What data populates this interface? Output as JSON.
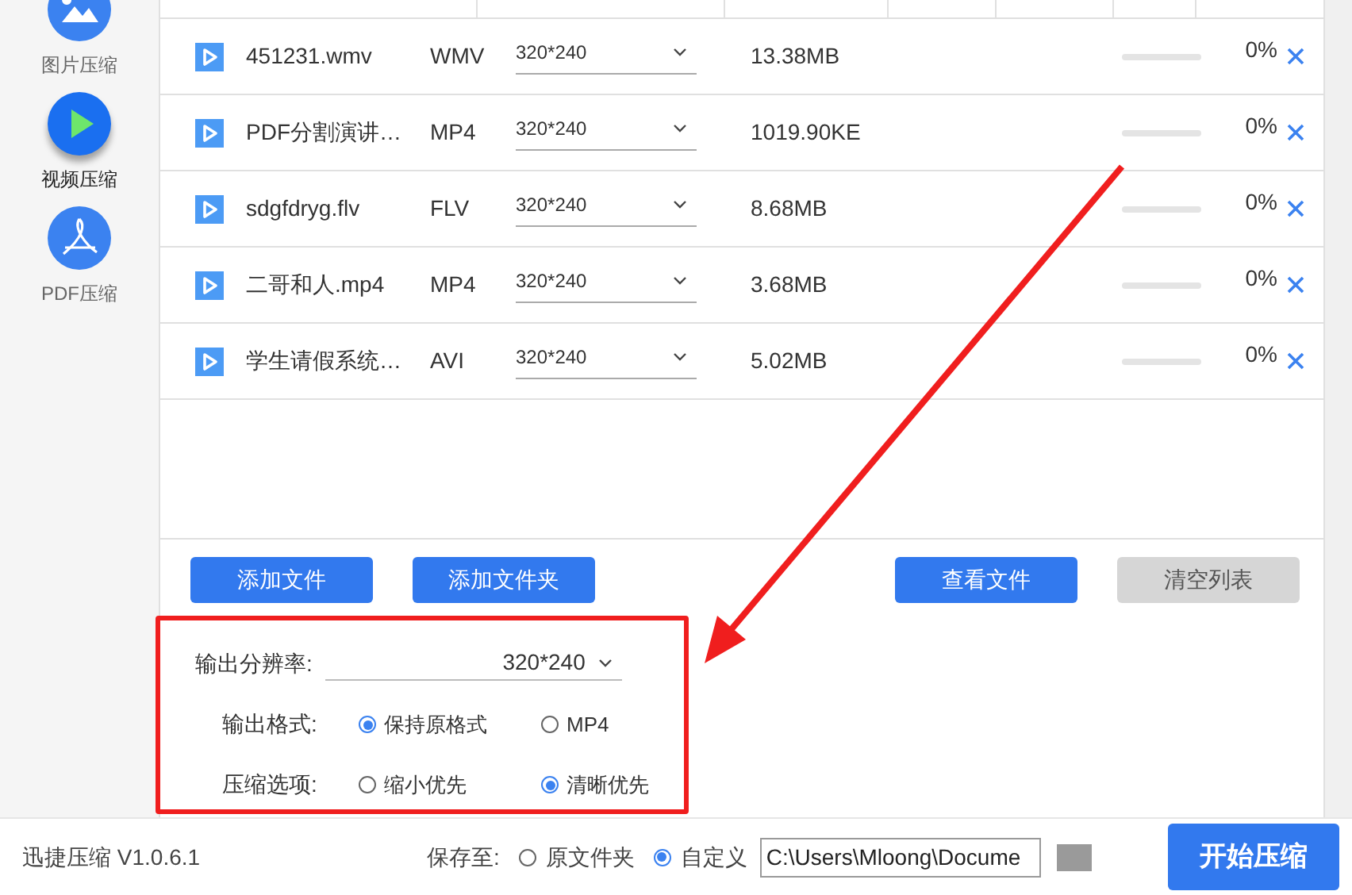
{
  "sidebar": {
    "items": [
      {
        "label": "图片压缩",
        "kind": "image",
        "selected": false
      },
      {
        "label": "视频压缩",
        "kind": "video",
        "selected": true
      },
      {
        "label": "PDF压缩",
        "kind": "pdf",
        "selected": false
      }
    ]
  },
  "files": [
    {
      "name": "451231.wmv",
      "format": "WMV",
      "resolution": "320*240",
      "size": "13.38MB",
      "level": 0,
      "percent": "0%"
    },
    {
      "name": "PDF分割演讲…",
      "format": "MP4",
      "resolution": "320*240",
      "size": "1019.90KE",
      "level": 0,
      "percent": "0%"
    },
    {
      "name": "sdgfdryg.flv",
      "format": "FLV",
      "resolution": "320*240",
      "size": "8.68MB",
      "level": 0,
      "percent": "0%"
    },
    {
      "name": "二哥和人.mp4",
      "format": "MP4",
      "resolution": "320*240",
      "size": "3.68MB",
      "level": 0,
      "percent": "0%"
    },
    {
      "name": "学生请假系统…",
      "format": "AVI",
      "resolution": "320*240",
      "size": "5.02MB",
      "level": 0,
      "percent": "0%"
    }
  ],
  "actions_left": [
    {
      "label": "添加文件",
      "disabled": false
    },
    {
      "label": "添加文件夹",
      "disabled": false
    }
  ],
  "actions_right": [
    {
      "label": "查看文件",
      "disabled": false
    },
    {
      "label": "清空列表",
      "disabled": true
    }
  ],
  "settings": {
    "resolution_label": "输出分辨率:",
    "resolution": "320*240",
    "groups": [
      {
        "label": "输出格式:",
        "options": [
          {
            "label": "保持原格式",
            "selected": true
          },
          {
            "label": "MP4",
            "selected": false
          }
        ]
      },
      {
        "label": "压缩选项:",
        "options": [
          {
            "label": "缩小优先",
            "selected": false
          },
          {
            "label": "清晰优先",
            "selected": true
          }
        ]
      }
    ]
  },
  "footer": {
    "version": "迅捷压缩 V1.0.6.1",
    "save_label": "保存至:",
    "save_options": [
      {
        "label": "原文件夹",
        "selected": false
      },
      {
        "label": "自定义",
        "selected": true
      }
    ],
    "path": "C:\\Users\\Mloong\\Docume",
    "start": "开始压缩"
  }
}
